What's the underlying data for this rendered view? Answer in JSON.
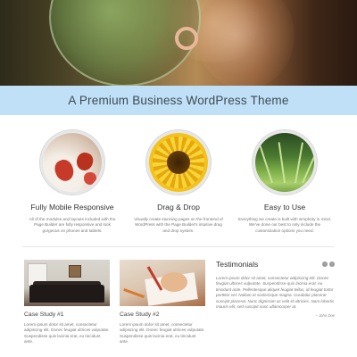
{
  "hero": {
    "image": "bubble-photo"
  },
  "title_bar": {
    "title": "A Premium Business WordPress Theme"
  },
  "features": [
    {
      "icon": "strawberries-photo",
      "title": "Fully Mobile Responsive",
      "text": "All of the modules and layouts included with the Page Builder are fully responsive and look gorgeous on phones and tablets."
    },
    {
      "icon": "sunflower-photo",
      "title": "Drag & Drop",
      "text": "Visually create stunning pages on the frontend of WordPress with the Page Builder's intuitive drag and drop system."
    },
    {
      "icon": "grass-photo",
      "title": "Easy to Use",
      "text": "Everything we create is built with simplicity in mind. We've done our best to only include the customization options you need."
    }
  ],
  "case_studies": [
    {
      "image": "living-room-photo",
      "title": "Case Study #1",
      "text": "Lorem ipsum dolor sit amet, consectetur adipiscing elit. Donec feugiat ultrices vulputate. Suspendisse quis lacinia erat, eu tincidunt ante."
    },
    {
      "image": "drawing-desk-photo",
      "title": "Case Study #2",
      "text": "Lorem ipsum dolor sit amet, consectetur adipiscing elit. Donec feugiat ultrices vulputate. Suspendisse quis lacinia erat, eu tincidunt ante."
    }
  ],
  "testimonials": {
    "title": "Testimonials",
    "prev": "‹",
    "next": "›",
    "quote": "Lorem ipsum dolor sit amet, consectetur adipiscing elit. Donec feugiat ultrices vulputate. Suspendisse quis lacinia erat, eu tincidunt ante. Pellentesque aliquet feugiat tellus, id feugiat tortor porttitor vel. Nullam et scelerisque magna. Curabitur placerat suscipit placerat. Nunc dignissim ac velit id ultricies. Nam lobortis mauris elit, sed suscipit nunc ullamcorper at.",
    "author": "– John Doe"
  },
  "colors": {
    "title_bar_bg": "#bfe0f6",
    "title_text": "#3f4a54"
  }
}
